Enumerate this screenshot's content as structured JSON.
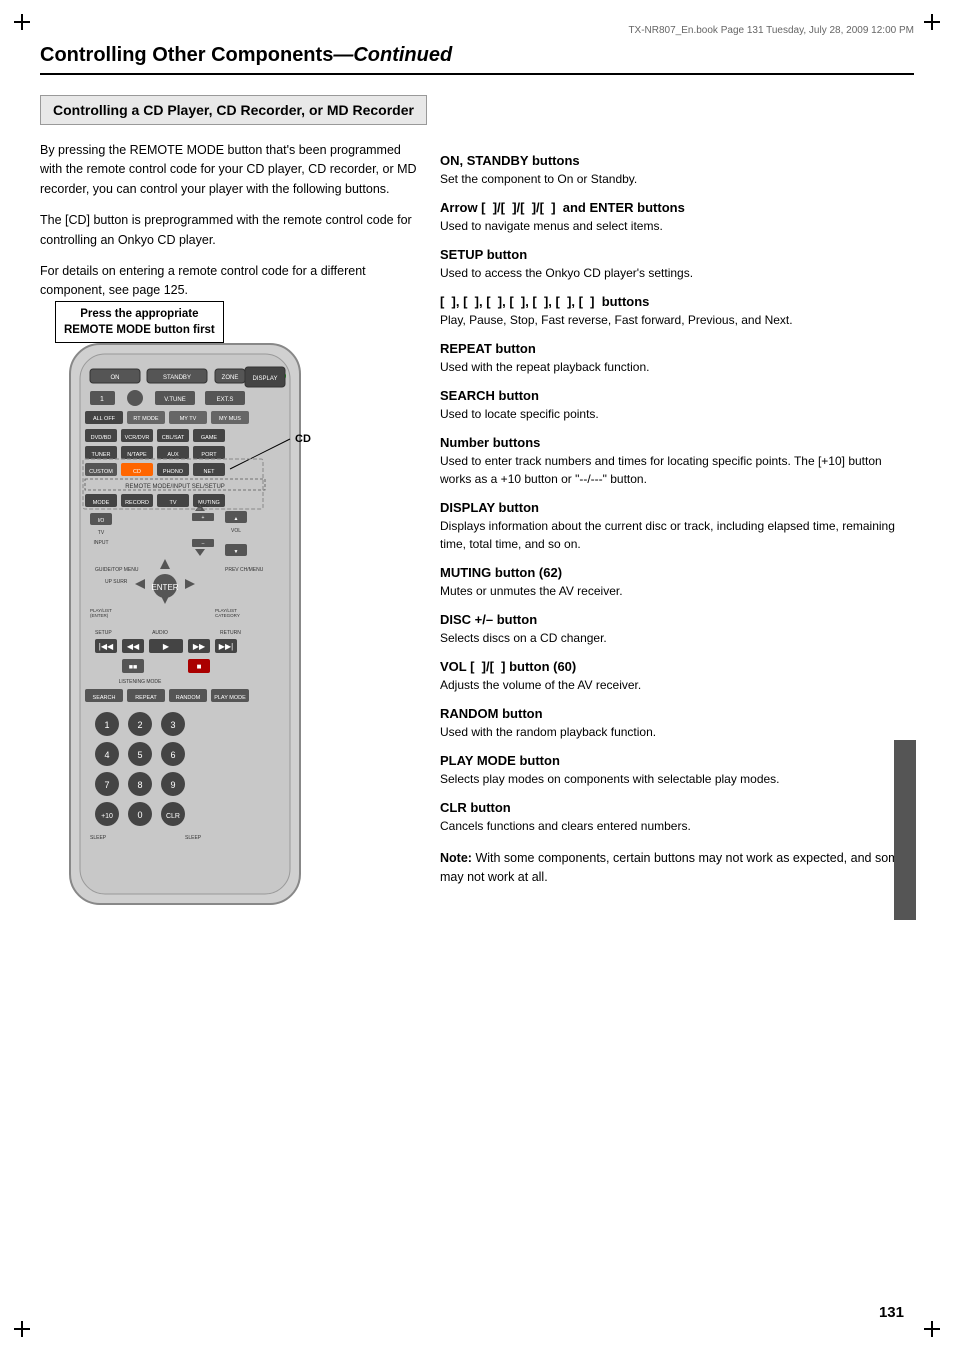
{
  "page": {
    "file_info": "TX-NR807_En.book   Page 131   Tuesday, July 28, 2009   12:00 PM",
    "header": {
      "title_bold": "Controlling Other Components",
      "title_italic": "—Continued"
    },
    "section_title": "Controlling a CD Player, CD Recorder, or MD Recorder",
    "page_number": "131"
  },
  "left_column": {
    "intro_paragraphs": [
      "By pressing the REMOTE MODE button that's been programmed with the remote control code for your CD player, CD recorder, or MD recorder, you can control your player with the following buttons.",
      "The [CD] button is preprogrammed with the remote control code for controlling an Onkyo CD player.",
      "For details on entering a remote control code for a different component, see page 125."
    ],
    "callout_text": "Press the appropriate\nREMOTE MODE button first",
    "cd_label": "CD"
  },
  "right_column": {
    "items": [
      {
        "heading": "ON, STANDBY buttons",
        "description": "Set the component to On or Standby."
      },
      {
        "heading": "Arrow [  ]/[  ]/[  ]/[  ]  and ENTER buttons",
        "description": "Used to navigate menus and select items."
      },
      {
        "heading": "SETUP button",
        "description": "Used to access the Onkyo CD player's settings."
      },
      {
        "heading": "[  ], [  ], [  ], [  ], [  ], [  ], [  ]  buttons",
        "description": "Play, Pause, Stop, Fast reverse, Fast forward, Previous, and Next."
      },
      {
        "heading": "REPEAT button",
        "description": "Used with the repeat playback function."
      },
      {
        "heading": "SEARCH button",
        "description": "Used to locate specific points."
      },
      {
        "heading": "Number buttons",
        "description": "Used to enter track numbers and times for locating specific points. The [+10] button works as a +10 button or \"--/---\" button."
      },
      {
        "heading": "DISPLAY button",
        "description": "Displays information about the current disc or track, including elapsed time, remaining time, total time, and so on."
      },
      {
        "heading": "MUTING button (62)",
        "description": "Mutes or unmutes the AV receiver."
      },
      {
        "heading": "DISC +/– button",
        "description": "Selects discs on a CD changer."
      },
      {
        "heading": "VOL [  ]/[  ] button (60)",
        "description": "Adjusts the volume of the AV receiver."
      },
      {
        "heading": "RANDOM button",
        "description": "Used with the random playback function."
      },
      {
        "heading": "PLAY MODE button",
        "description": "Selects play modes on components with selectable play modes."
      },
      {
        "heading": "CLR button",
        "description": "Cancels functions and clears entered numbers."
      }
    ],
    "note": {
      "label": "Note:",
      "text": "With some components, certain buttons may not work as expected, and some may not work at all."
    }
  }
}
